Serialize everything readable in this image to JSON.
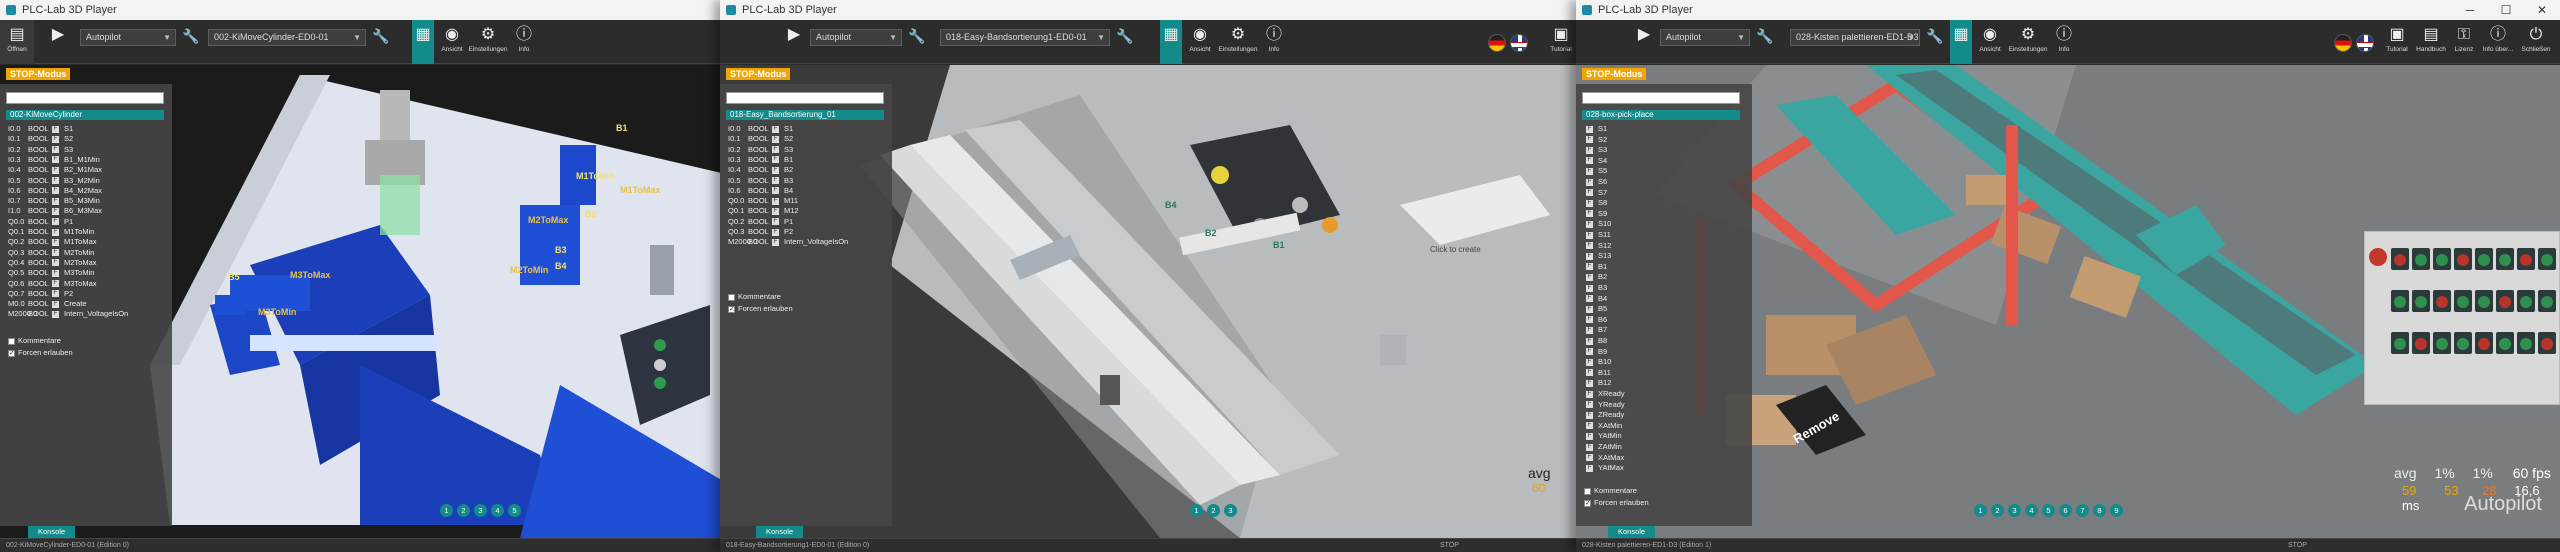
{
  "app": {
    "title": "PLC-Lab 3D Player",
    "accent": "#138b8b",
    "mode_badge": "STOP-Modus",
    "mode_badge_color": "#f0a500"
  },
  "toolbar": {
    "open_label": "Öffnen",
    "mode_value": "Autopilot",
    "view_label": "Ansicht",
    "settings_label": "Einstellungen",
    "info_label": "Info",
    "tutorial_label": "Tutorial",
    "handbook_label": "Handbuch",
    "license_label": "Lizenz",
    "infoabout_label": "Info über...",
    "close_label": "Schließen"
  },
  "window1": {
    "scene_select": "002-KiMoveCylinder-ED0-01",
    "list_header": "002-KiMoveCylinder",
    "rows": [
      {
        "addr": "I0.0",
        "type": "BOOL",
        "name": "S1"
      },
      {
        "addr": "I0.1",
        "type": "BOOL",
        "name": "S2"
      },
      {
        "addr": "I0.2",
        "type": "BOOL",
        "name": "S3"
      },
      {
        "addr": "I0.3",
        "type": "BOOL",
        "name": "B1_M1Min"
      },
      {
        "addr": "I0.4",
        "type": "BOOL",
        "name": "B2_M1Max"
      },
      {
        "addr": "I0.5",
        "type": "BOOL",
        "name": "B3_M2Min"
      },
      {
        "addr": "I0.6",
        "type": "BOOL",
        "name": "B4_M2Max"
      },
      {
        "addr": "I0.7",
        "type": "BOOL",
        "name": "B5_M3Min"
      },
      {
        "addr": "I1.0",
        "type": "BOOL",
        "name": "B6_M3Max"
      },
      {
        "addr": "Q0.0",
        "type": "BOOL",
        "name": "P1"
      },
      {
        "addr": "Q0.1",
        "type": "BOOL",
        "name": "M1ToMin"
      },
      {
        "addr": "Q0.2",
        "type": "BOOL",
        "name": "M1ToMax"
      },
      {
        "addr": "Q0.3",
        "type": "BOOL",
        "name": "M2ToMin"
      },
      {
        "addr": "Q0.4",
        "type": "BOOL",
        "name": "M2ToMax"
      },
      {
        "addr": "Q0.5",
        "type": "BOOL",
        "name": "M3ToMin"
      },
      {
        "addr": "Q0.6",
        "type": "BOOL",
        "name": "M3ToMax"
      },
      {
        "addr": "Q0.7",
        "type": "BOOL",
        "name": "P2"
      },
      {
        "addr": "M0.0",
        "type": "BOOL",
        "name": "Create"
      },
      {
        "addr": "M2000.0",
        "type": "BOOL",
        "name": "Intern_VoltageIsOn"
      }
    ],
    "comments_label": "Kommentare",
    "force_label": "Forcen erlauben",
    "console_label": "Konsole",
    "pages": [
      "1",
      "2",
      "3",
      "4",
      "5"
    ],
    "status_text": "002-KiMoveCylinder-ED0-01 (Edition 0)",
    "scene_labels": [
      "B1",
      "B2",
      "B3",
      "B4",
      "B5",
      "M1ToMin",
      "M1ToMax",
      "M2ToMin",
      "M2ToMax",
      "M3ToMin",
      "M3ToMax"
    ]
  },
  "window2": {
    "mode_value": "Autopilot",
    "scene_select": "018-Easy-Bandsortierung1-ED0-01",
    "list_header": "018-Easy_Bandsortierung_01",
    "rows": [
      {
        "addr": "I0.0",
        "type": "BOOL",
        "name": "S1"
      },
      {
        "addr": "I0.1",
        "type": "BOOL",
        "name": "S2"
      },
      {
        "addr": "I0.2",
        "type": "BOOL",
        "name": "S3"
      },
      {
        "addr": "I0.3",
        "type": "BOOL",
        "name": "B1"
      },
      {
        "addr": "I0.4",
        "type": "BOOL",
        "name": "B2"
      },
      {
        "addr": "I0.5",
        "type": "BOOL",
        "name": "B3"
      },
      {
        "addr": "I0.6",
        "type": "BOOL",
        "name": "B4"
      },
      {
        "addr": "Q0.0",
        "type": "BOOL",
        "name": "M11"
      },
      {
        "addr": "Q0.1",
        "type": "BOOL",
        "name": "M12"
      },
      {
        "addr": "Q0.2",
        "type": "BOOL",
        "name": "P1"
      },
      {
        "addr": "Q0.3",
        "type": "BOOL",
        "name": "P2"
      },
      {
        "addr": "M2000.0",
        "type": "BOOL",
        "name": "Intern_VoltageIsOn"
      }
    ],
    "comments_label": "Kommentare",
    "force_label": "Forcen erlauben",
    "console_label": "Konsole",
    "pages": [
      "1",
      "2",
      "3"
    ],
    "status_text": "018-Easy-Bandsortierung1-ED0-01 (Edition 0)",
    "status_right": "STOP",
    "click_to_create": "Click to create",
    "scene_labels": [
      "B4",
      "B2",
      "B1"
    ],
    "avg_label": "avg",
    "avg_value": "60"
  },
  "window3": {
    "mode_value": "Autopilot",
    "scene_select": "028-Kisten palettieren-ED1-D3",
    "list_header": "028-box-pick-place",
    "rows": [
      "S1",
      "S2",
      "S3",
      "S4",
      "S5",
      "S6",
      "S7",
      "S8",
      "S9",
      "S10",
      "S11",
      "S12",
      "S13",
      "B1",
      "B2",
      "B3",
      "B4",
      "B5",
      "B6",
      "B7",
      "B8",
      "B9",
      "B10",
      "B11",
      "B12",
      "XReady",
      "YReady",
      "ZReady",
      "XAtMin",
      "YAtMin",
      "ZAtMin",
      "XAtMax",
      "YAtMax"
    ],
    "console_label": "Konsole",
    "comments_label": "Kommentare",
    "force_label": "Forcen erlauben",
    "pages": [
      "1",
      "2",
      "3",
      "4",
      "5",
      "6",
      "7",
      "8",
      "9"
    ],
    "status_text": "028-Kisten palettieren-ED1-D3 (Edition 1)",
    "status_right": "STOP",
    "remove_label": "Remove",
    "fps": {
      "avg_label": "avg",
      "avg_value": "59",
      "cpu1_label": "1%",
      "cpu1_value": "53",
      "cpu2_label": "1%",
      "cpu2_value": "28",
      "fps_label": "60 fps",
      "ms_label": "16,6 ms"
    },
    "autopilot_label": "Autopilot"
  }
}
